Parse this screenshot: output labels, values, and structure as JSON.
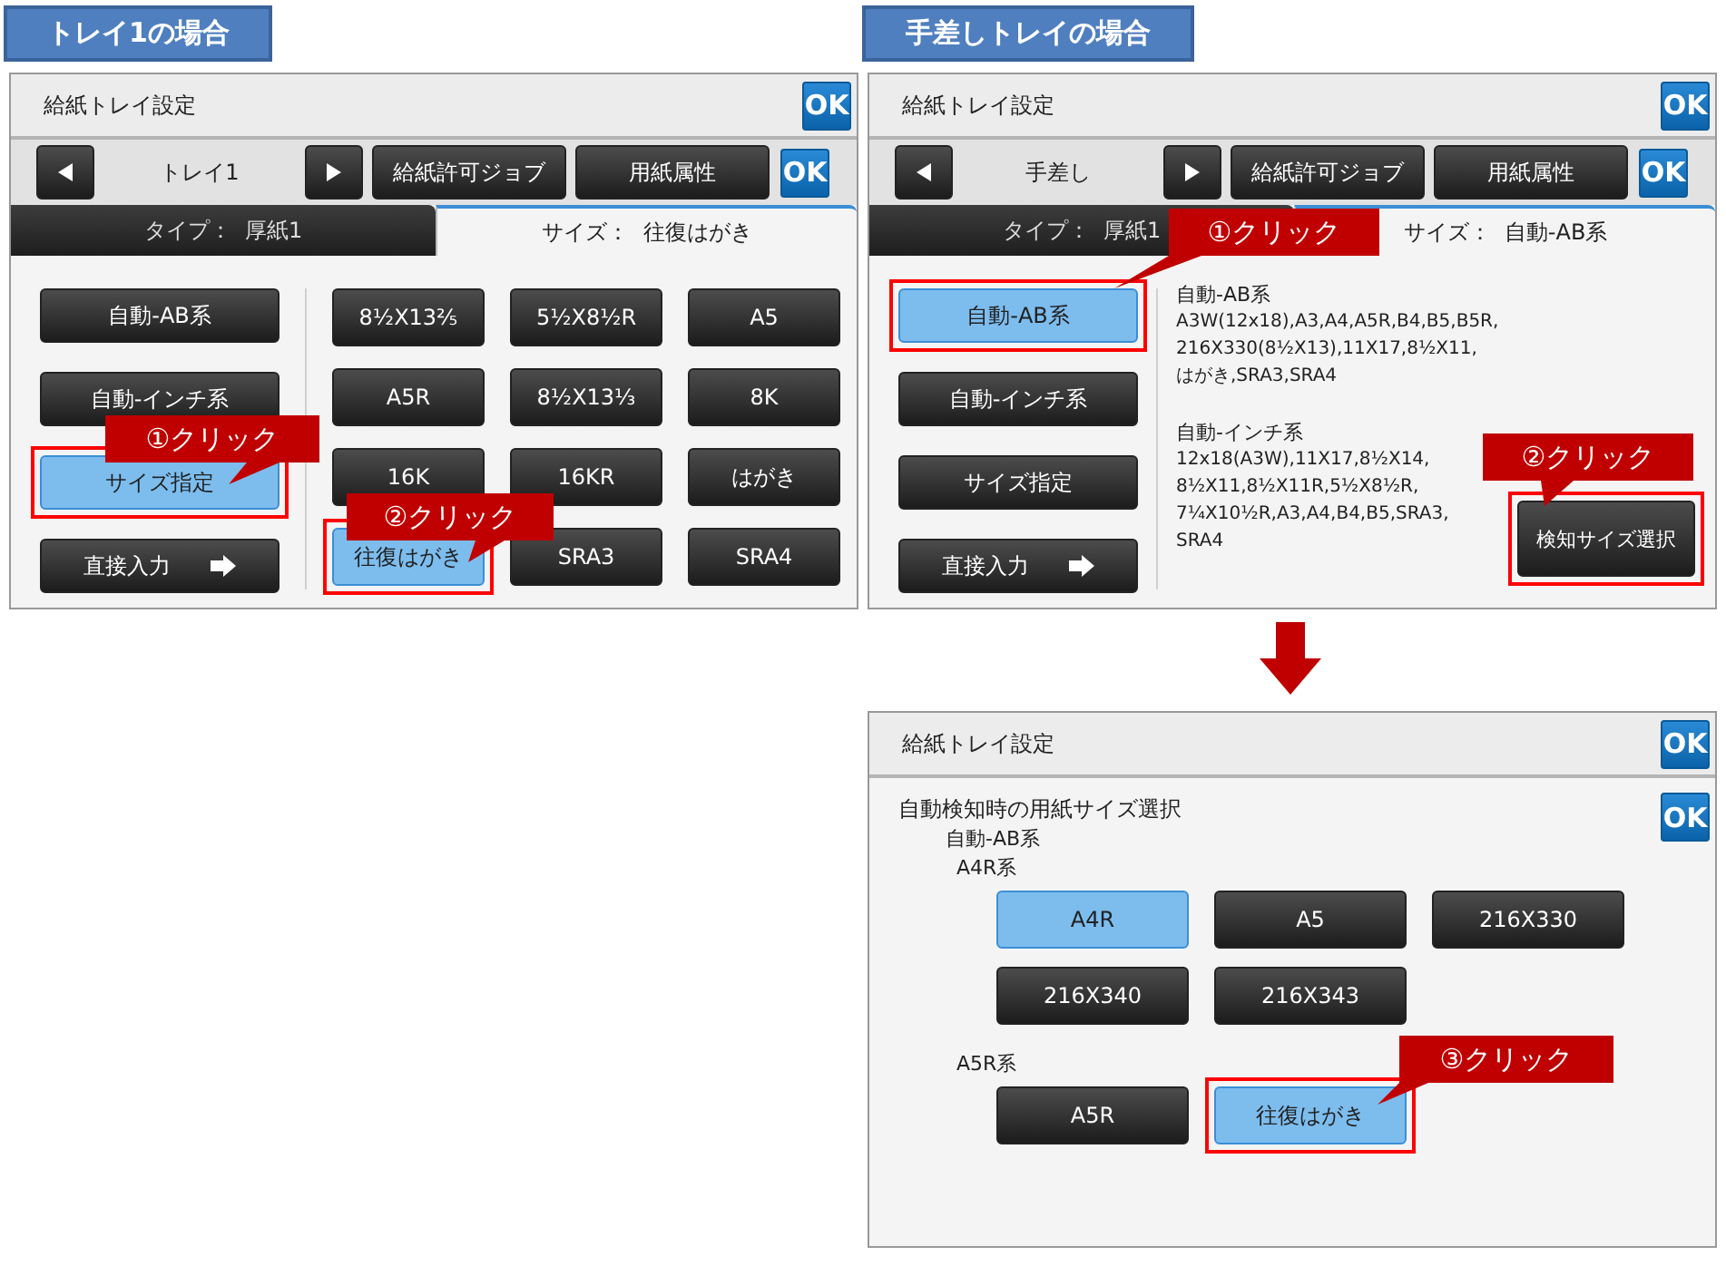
{
  "screens": [
    {
      "kind": "tray",
      "heading": "トレイ1の場合",
      "title": "給紙トレイ設定",
      "ok": "OK",
      "tray": "トレイ1",
      "nav_buttons": [
        "給紙許可ジョブ",
        "用紙属性"
      ],
      "nav_ok": "OK",
      "tabs": [
        {
          "label": "タイプ：",
          "value": "厚紙1",
          "selected": false
        },
        {
          "label": "サイズ：",
          "value": "往復はがき",
          "selected": true
        }
      ],
      "modes": [
        {
          "label": "自動-AB系",
          "kind": "plain",
          "selected": false,
          "highlighted": false
        },
        {
          "label": "自動-インチ系",
          "kind": "plain",
          "selected": false,
          "highlighted": false
        },
        {
          "label": "サイズ指定",
          "kind": "plain",
          "selected": true,
          "highlighted": true
        },
        {
          "label": "直接入力",
          "kind": "arrow",
          "selected": false,
          "highlighted": false
        }
      ],
      "content": {
        "kind": "size_grid",
        "sizes": [
          {
            "label": "8½X13⅖",
            "selected": false,
            "highlighted": false
          },
          {
            "label": "5½X8½R",
            "selected": false,
            "highlighted": false
          },
          {
            "label": "A5",
            "selected": false,
            "highlighted": false
          },
          {
            "label": "A5R",
            "selected": false,
            "highlighted": false
          },
          {
            "label": "8½X13⅓",
            "selected": false,
            "highlighted": false
          },
          {
            "label": "8K",
            "selected": false,
            "highlighted": false
          },
          {
            "label": "16K",
            "selected": false,
            "highlighted": false
          },
          {
            "label": "16KR",
            "selected": false,
            "highlighted": false
          },
          {
            "label": "はがき",
            "selected": false,
            "highlighted": false
          },
          {
            "label": "往復はがき",
            "selected": true,
            "highlighted": true
          },
          {
            "label": "SRA3",
            "selected": false,
            "highlighted": false
          },
          {
            "label": "SRA4",
            "selected": false,
            "highlighted": false
          }
        ]
      },
      "callouts": [
        {
          "text": "①クリック"
        },
        {
          "text": "②クリック"
        }
      ]
    },
    {
      "kind": "tray",
      "heading": "手差しトレイの場合",
      "title": "給紙トレイ設定",
      "ok": "OK",
      "tray": "手差し",
      "nav_buttons": [
        "給紙許可ジョブ",
        "用紙属性"
      ],
      "nav_ok": "OK",
      "tabs": [
        {
          "label": "タイプ：",
          "value": "厚紙1",
          "selected": false
        },
        {
          "label": "サイズ：",
          "value": "自動-AB系",
          "selected": true
        }
      ],
      "modes": [
        {
          "label": "自動-AB系",
          "kind": "plain",
          "selected": true,
          "highlighted": true
        },
        {
          "label": "自動-インチ系",
          "kind": "plain",
          "selected": false,
          "highlighted": false
        },
        {
          "label": "サイズ指定",
          "kind": "plain",
          "selected": false,
          "highlighted": false
        },
        {
          "label": "直接入力",
          "kind": "arrow",
          "selected": false,
          "highlighted": false
        }
      ],
      "content": {
        "kind": "size_list",
        "groups": [
          {
            "name": "自動-AB系",
            "lines": [
              "A3W(12x18),A3,A4,A5R,B4,B5,B5R,",
              "216X330(8½X13),11X17,8½X11,",
              "はがき,SRA3,SRA4"
            ]
          },
          {
            "name": "自動-インチ系",
            "lines": [
              "12x18(A3W),11X17,8½X14,",
              "8½X11,8½X11R,5½X8½R,",
              "7¼X10½R,A3,A4,B4,B5,SRA3,",
              "SRA4"
            ]
          }
        ],
        "button": {
          "label": "検知サイズ選択",
          "highlighted": true
        }
      },
      "callouts": [
        {
          "text": "①クリック"
        },
        {
          "text": "②クリック"
        }
      ]
    },
    {
      "kind": "detect",
      "title": "給紙トレイ設定",
      "ok": "OK",
      "body_ok": "OK",
      "heading": "自動検知時の用紙サイズ選択",
      "subheading": "自動-AB系",
      "groups": [
        {
          "name": "A4R系",
          "sizes": [
            {
              "label": "A4R",
              "selected": true,
              "highlighted": false
            },
            {
              "label": "A5",
              "selected": false,
              "highlighted": false
            },
            {
              "label": "216X330",
              "selected": false,
              "highlighted": false
            },
            {
              "label": "216X340",
              "selected": false,
              "highlighted": false
            },
            {
              "label": "216X343",
              "selected": false,
              "highlighted": false
            }
          ]
        },
        {
          "name": "A5R系",
          "sizes": [
            {
              "label": "A5R",
              "selected": false,
              "highlighted": false
            },
            {
              "label": "往復はがき",
              "selected": true,
              "highlighted": true
            }
          ]
        }
      ],
      "callouts": [
        {
          "text": "③クリック"
        }
      ]
    }
  ]
}
